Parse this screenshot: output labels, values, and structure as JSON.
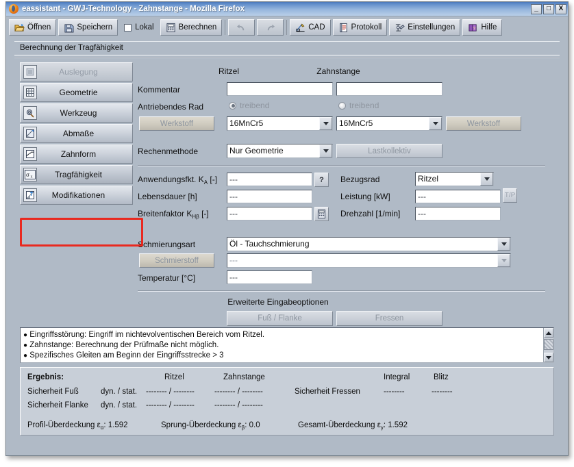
{
  "window": {
    "title": "eassistant - GWJ-Technology - Zahnstange - Mozilla Firefox",
    "app_icon": "firefox-icon",
    "controls": {
      "minimize": "_",
      "maximize": "□",
      "close": "X"
    }
  },
  "toolbar": {
    "buttons": [
      {
        "label": "Öffnen",
        "icon": "open-folder-icon",
        "disabled": false
      },
      {
        "label": "Speichern",
        "icon": "floppy-disk-icon",
        "disabled": false
      },
      {
        "label": "Berechnen",
        "icon": "calculator-icon",
        "disabled": false
      },
      {
        "label": "CAD",
        "icon": "cad-pencil-icon",
        "disabled": false
      },
      {
        "label": "Protokoll",
        "icon": "document-icon",
        "disabled": false
      },
      {
        "label": "Einstellungen",
        "icon": "settings-tool-icon",
        "disabled": false
      },
      {
        "label": "Hilfe",
        "icon": "help-book-icon",
        "disabled": false
      }
    ],
    "checkbox": {
      "label": "Lokal",
      "checked": false
    },
    "undo": {
      "icon": "undo-arrow-icon",
      "disabled": true
    },
    "redo": {
      "icon": "redo-arrow-icon",
      "disabled": true
    }
  },
  "page": {
    "title": "Berechnung der Tragfähigkeit"
  },
  "sidebar": {
    "items": [
      {
        "label": "Auslegung",
        "icon": "auslegung-icon",
        "disabled": true,
        "selected": false
      },
      {
        "label": "Geometrie",
        "icon": "grid-icon",
        "disabled": false,
        "selected": false
      },
      {
        "label": "Werkzeug",
        "icon": "gear-tool-icon",
        "disabled": false,
        "selected": false
      },
      {
        "label": "Abmaße",
        "icon": "ruler-icon",
        "disabled": false,
        "selected": false
      },
      {
        "label": "Zahnform",
        "icon": "tooth-profile-icon",
        "disabled": false,
        "selected": false
      },
      {
        "label": "Tragfähigkeit",
        "icon": "sigma-x-icon",
        "disabled": false,
        "selected": true
      },
      {
        "label": "Modifikationen",
        "icon": "modification-icon",
        "disabled": false,
        "selected": false
      }
    ]
  },
  "form": {
    "column_headers": {
      "left": "Ritzel",
      "right": "Zahnstange"
    },
    "kommentar": {
      "label": "Kommentar",
      "ritzel_value": "",
      "zahnstange_value": ""
    },
    "antriebendes_rad": {
      "label": "Antriebendes Rad",
      "ritzel_radio_label": "treibend",
      "zahnstange_radio_label": "treibend",
      "selected": "ritzel"
    },
    "werkstoff": {
      "left_button": "Werkstoff",
      "right_button": "Werkstoff",
      "ritzel_value": "16MnCr5",
      "zahnstange_value": "16MnCr5"
    },
    "rechenmethode": {
      "label": "Rechenmethode",
      "value": "Nur Geometrie",
      "lastkollektiv_button": "Lastkollektiv"
    },
    "anwendungsfkt": {
      "label_pre": "Anwendungsfkt. K",
      "label_sub": "A",
      "label_post": " [-]",
      "value": "---",
      "help_button": "?"
    },
    "lebensdauer": {
      "label": "Lebensdauer [h]",
      "value": "---"
    },
    "breitenfaktor": {
      "label_pre": "Breitenfaktor K",
      "label_sub": "Hβ",
      "label_post": " [-]",
      "value": "---",
      "calc_button_icon": "calculator-small-icon"
    },
    "bezugsrad": {
      "label": "Bezugsrad",
      "value": "Ritzel"
    },
    "leistung": {
      "label": "Leistung [kW]",
      "value": "---",
      "tp_button": "T/P"
    },
    "drehzahl": {
      "label": "Drehzahl [1/min]",
      "value": "---"
    },
    "schmierungsart": {
      "label": "Schmierungsart",
      "value": "Öl - Tauchschmierung"
    },
    "schmierstoff": {
      "button": "Schmierstoff",
      "value": "---"
    },
    "temperatur": {
      "label": "Temperatur [°C]",
      "value": "---"
    },
    "erweitert": {
      "title": "Erweiterte Eingabeoptionen",
      "buttons": [
        "Fuß / Flanke",
        "Fressen"
      ]
    }
  },
  "messages": {
    "items": [
      "Eingriffsstörung: Eingriff im nichtevolventischen Bereich vom Ritzel.",
      "Zahnstange: Berechnung der Prüfmaße nicht möglich.",
      "Spezifisches Gleiten am Beginn der Eingriffsstrecke > 3"
    ],
    "scrollbar": {
      "up": "scroll-up-arrow",
      "down": "scroll-down-arrow"
    }
  },
  "result": {
    "title": "Ergebnis:",
    "headers": {
      "ritzel": "Ritzel",
      "zahnstange": "Zahnstange",
      "integral": "Integral",
      "blitz": "Blitz"
    },
    "rows": [
      {
        "label": "Sicherheit Fuß",
        "mode": "dyn. / stat.",
        "ritzel": "--------  / --------",
        "zahnstange": "--------  / --------"
      },
      {
        "label": "Sicherheit Flanke",
        "mode": "dyn. / stat.",
        "ritzel": "--------  / --------",
        "zahnstange": "--------  / --------"
      }
    ],
    "fressen": {
      "label": "Sicherheit Fressen",
      "integral": "--------",
      "blitz": "--------"
    },
    "overlaps": [
      {
        "label_pre": "Profil-Überdeckung ε",
        "sub": "α",
        "label_post": ": ",
        "value": "1.592"
      },
      {
        "label_pre": "Sprung-Überdeckung ε",
        "sub": "β",
        "label_post": ": ",
        "value": "0.0"
      },
      {
        "label_pre": "Gesamt-Überdeckung ε",
        "sub": "γ",
        "label_post": ": ",
        "value": "1.592"
      }
    ]
  },
  "annotation": {
    "type": "red-rectangle-highlight",
    "target": "sidebar-item-tragfaehigkeit",
    "color": "#ee1c10"
  },
  "colors": {
    "window_background": "#b0bac6",
    "title_bar": "#5f8cca",
    "result_panel": "#c8cfd8",
    "input_background": "#ffffff",
    "annotation": "#ee1c10"
  }
}
